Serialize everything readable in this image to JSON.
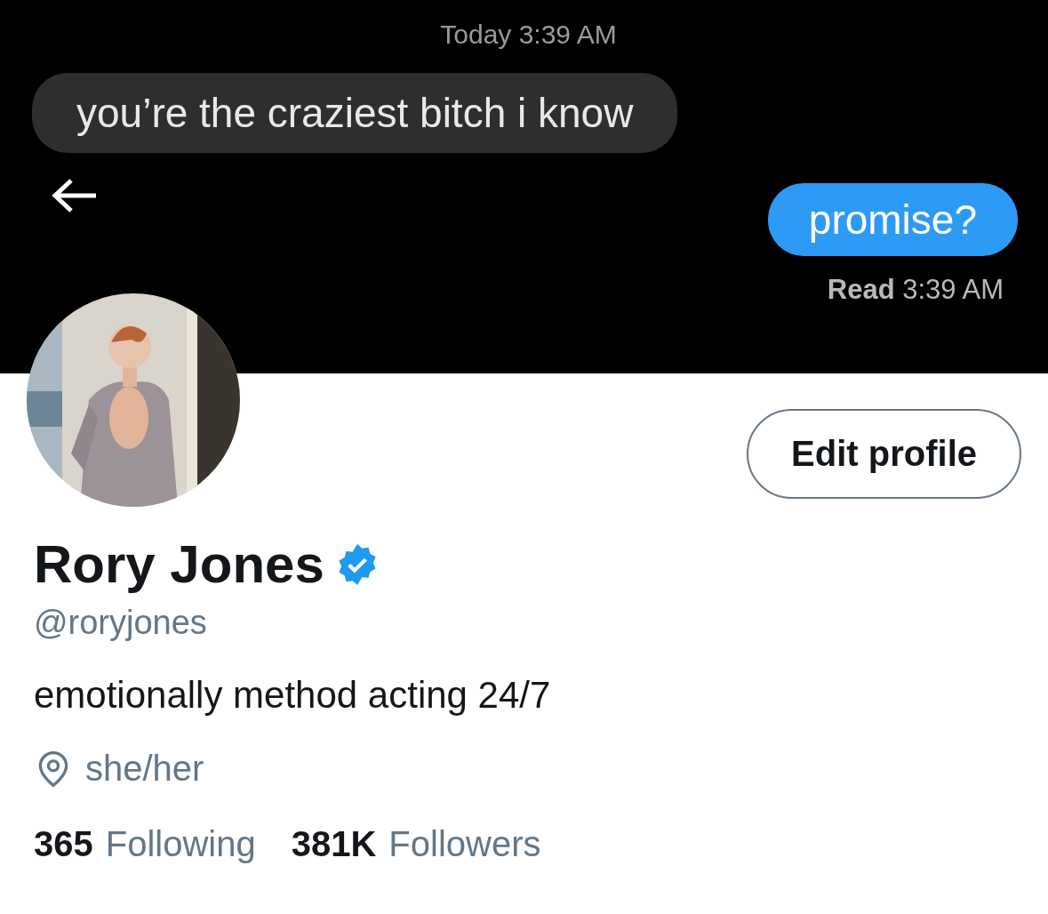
{
  "banner": {
    "timestamp": "Today 3:39 AM",
    "messages": [
      {
        "kind": "received",
        "text": "you’re the craziest bitch i know"
      },
      {
        "kind": "sent",
        "text": "promise?"
      }
    ],
    "receipt": {
      "label": "Read",
      "time": "3:39 AM"
    }
  },
  "edit_button": "Edit profile",
  "profile": {
    "name": "Rory Jones",
    "verified": true,
    "handle": "@roryjones",
    "bio": "emotionally method acting 24/7",
    "location": "she/her"
  },
  "stats": [
    {
      "count": "365",
      "label": "Following"
    },
    {
      "count": "381K",
      "label": "Followers"
    }
  ]
}
